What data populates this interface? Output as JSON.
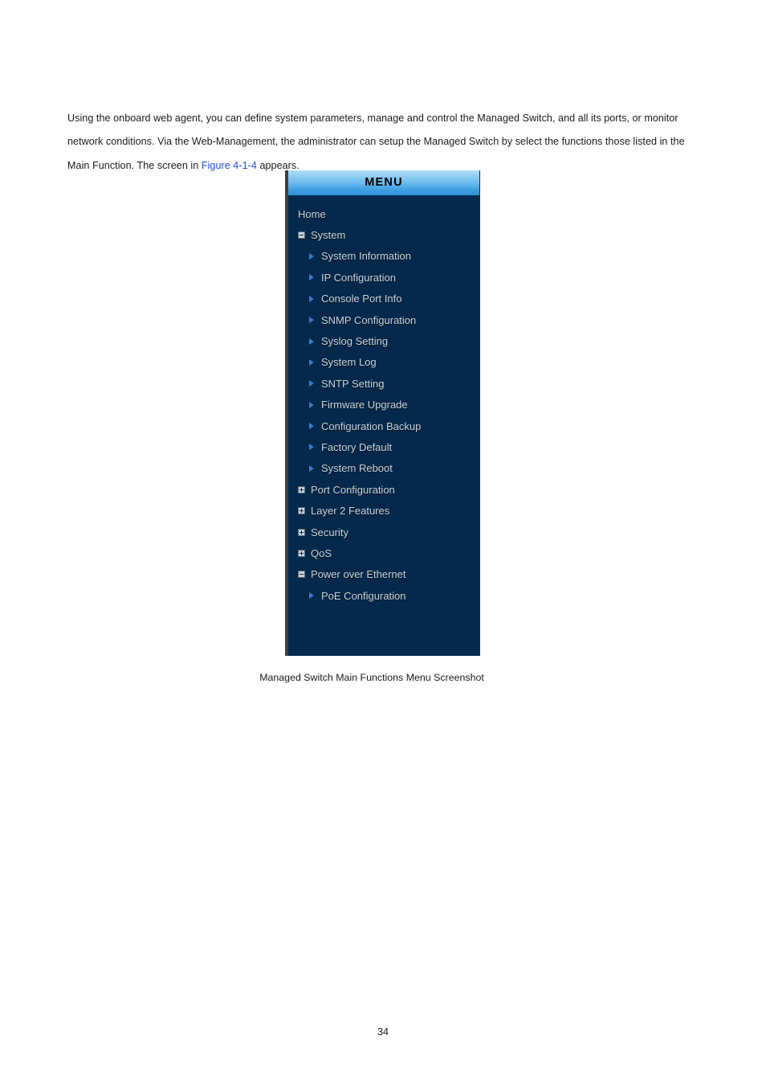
{
  "document": {
    "paragraph": {
      "part1": "Using the onboard web agent, you can define system parameters, manage and control the Managed Switch, and all its ports, or monitor network conditions. Via the Web-Management, the administrator can setup the Managed Switch by select the functions those listed in the Main Function. The screen in ",
      "link_text": "Figure 4-1-4",
      "part2": " appears."
    },
    "figure_caption": "Managed Switch Main Functions Menu Screenshot",
    "page_number": "34"
  },
  "menu_panel": {
    "header_title": "MENU",
    "colors": {
      "panel_background": "#04294d",
      "header_gradient_top": "#b2def7",
      "header_gradient_bottom": "#2f8fd6",
      "item_text": "#ccd4dc",
      "arrow_bullet": "#2f7fd4",
      "link_blue": "#1d4fd8",
      "left_border": "#3f3f41"
    },
    "items": [
      {
        "label": "Home",
        "level": 0,
        "icon": "none"
      },
      {
        "label": "System",
        "level": 0,
        "icon": "minus-box-icon"
      },
      {
        "label": "System Information",
        "level": 1,
        "icon": "arrow-right-icon"
      },
      {
        "label": "IP Configuration",
        "level": 1,
        "icon": "arrow-right-icon"
      },
      {
        "label": "Console Port Info",
        "level": 1,
        "icon": "arrow-right-icon"
      },
      {
        "label": "SNMP Configuration",
        "level": 1,
        "icon": "arrow-right-icon"
      },
      {
        "label": "Syslog Setting",
        "level": 1,
        "icon": "arrow-right-icon"
      },
      {
        "label": "System Log",
        "level": 1,
        "icon": "arrow-right-icon"
      },
      {
        "label": "SNTP Setting",
        "level": 1,
        "icon": "arrow-right-icon"
      },
      {
        "label": "Firmware Upgrade",
        "level": 1,
        "icon": "arrow-right-icon"
      },
      {
        "label": "Configuration Backup",
        "level": 1,
        "icon": "arrow-right-icon"
      },
      {
        "label": "Factory Default",
        "level": 1,
        "icon": "arrow-right-icon"
      },
      {
        "label": "System Reboot",
        "level": 1,
        "icon": "arrow-right-icon"
      },
      {
        "label": "Port Configuration",
        "level": 0,
        "icon": "plus-box-icon"
      },
      {
        "label": "Layer 2 Features",
        "level": 0,
        "icon": "plus-box-icon"
      },
      {
        "label": "Security",
        "level": 0,
        "icon": "plus-box-icon"
      },
      {
        "label": "QoS",
        "level": 0,
        "icon": "plus-box-icon"
      },
      {
        "label": "Power over Ethernet",
        "level": 0,
        "icon": "minus-box-icon"
      },
      {
        "label": "PoE Configuration",
        "level": 1,
        "icon": "arrow-right-icon"
      }
    ]
  }
}
